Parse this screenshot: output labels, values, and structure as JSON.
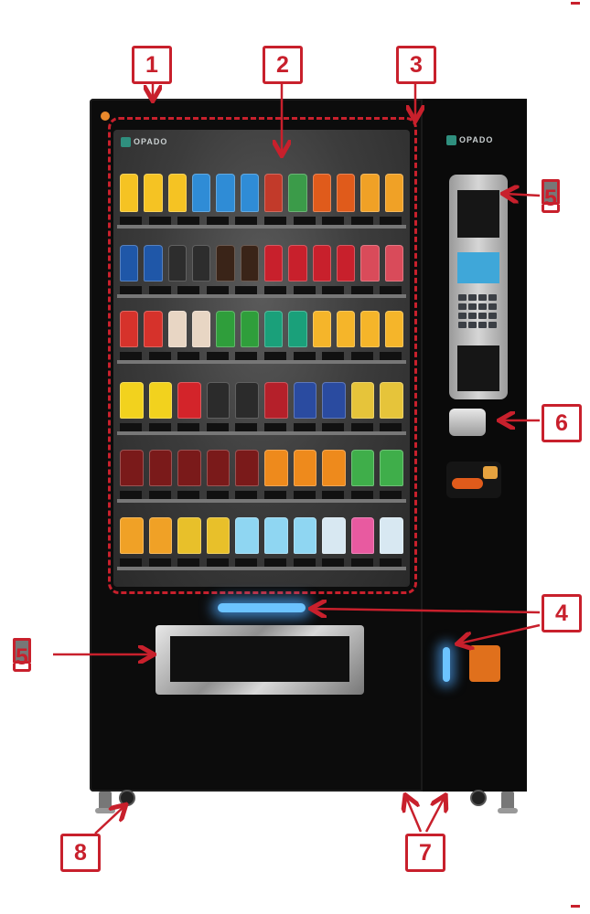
{
  "brand": {
    "name": "OPADO",
    "accent": "#c8202c",
    "led_color": "#6cc3ff"
  },
  "callouts": [
    {
      "id": "c1",
      "label": "1"
    },
    {
      "id": "c2",
      "label": "2"
    },
    {
      "id": "c3",
      "label": "3"
    },
    {
      "id": "c4",
      "label": "4"
    },
    {
      "id": "c5a",
      "label": "5"
    },
    {
      "id": "c5b",
      "label": "5"
    },
    {
      "id": "c6",
      "label": "6"
    },
    {
      "id": "c7",
      "label": "7"
    },
    {
      "id": "c8",
      "label": "8"
    }
  ],
  "shelves": [
    {
      "product_colors": [
        "#f5c323",
        "#f5c323",
        "#f5c323",
        "#2f8cd6",
        "#2f8cd6",
        "#2f8cd6",
        "#c23a2a",
        "#3b9b49",
        "#e05b1b",
        "#e05b1b",
        "#f0a126",
        "#f0a126"
      ]
    },
    {
      "product_colors": [
        "#1f57a8",
        "#1f57a8",
        "#2d2d2d",
        "#2d2d2d",
        "#3a2418",
        "#3a2418",
        "#c8202c",
        "#c8202c",
        "#c8202c",
        "#c8202c",
        "#d94b5a",
        "#d94b5a"
      ]
    },
    {
      "product_colors": [
        "#d6322b",
        "#d6322b",
        "#e8d6c4",
        "#e8d6c4",
        "#2f9e3b",
        "#2f9e3b",
        "#1aa07a",
        "#1aa07a",
        "#f5b52a",
        "#f5b52a",
        "#f5b52a",
        "#f5b52a"
      ]
    },
    {
      "product_colors": [
        "#f2d21e",
        "#f2d21e",
        "#d3242a",
        "#2b2b2b",
        "#2b2b2b",
        "#b5202a",
        "#2a4ba0",
        "#2a4ba0",
        "#e6c43a",
        "#e6c43a"
      ]
    },
    {
      "product_colors": [
        "#7a1a1a",
        "#7a1a1a",
        "#7a1a1a",
        "#7a1a1a",
        "#7a1a1a",
        "#ee8a1c",
        "#ee8a1c",
        "#ee8a1c",
        "#3fae4a",
        "#3fae4a"
      ]
    },
    {
      "product_colors": [
        "#f0a126",
        "#f0a126",
        "#e8c02a",
        "#e8c02a",
        "#8fd6f2",
        "#8fd6f2",
        "#8fd6f2",
        "#d8e8f2",
        "#e85aa0",
        "#d8e8f2"
      ]
    }
  ],
  "icons": [
    "card-reader-icon",
    "keypad-icon",
    "coin-slot-icon",
    "banknote-icon",
    "led-light-icon",
    "coin-return-icon",
    "wheel-icon",
    "leveling-foot-icon"
  ]
}
